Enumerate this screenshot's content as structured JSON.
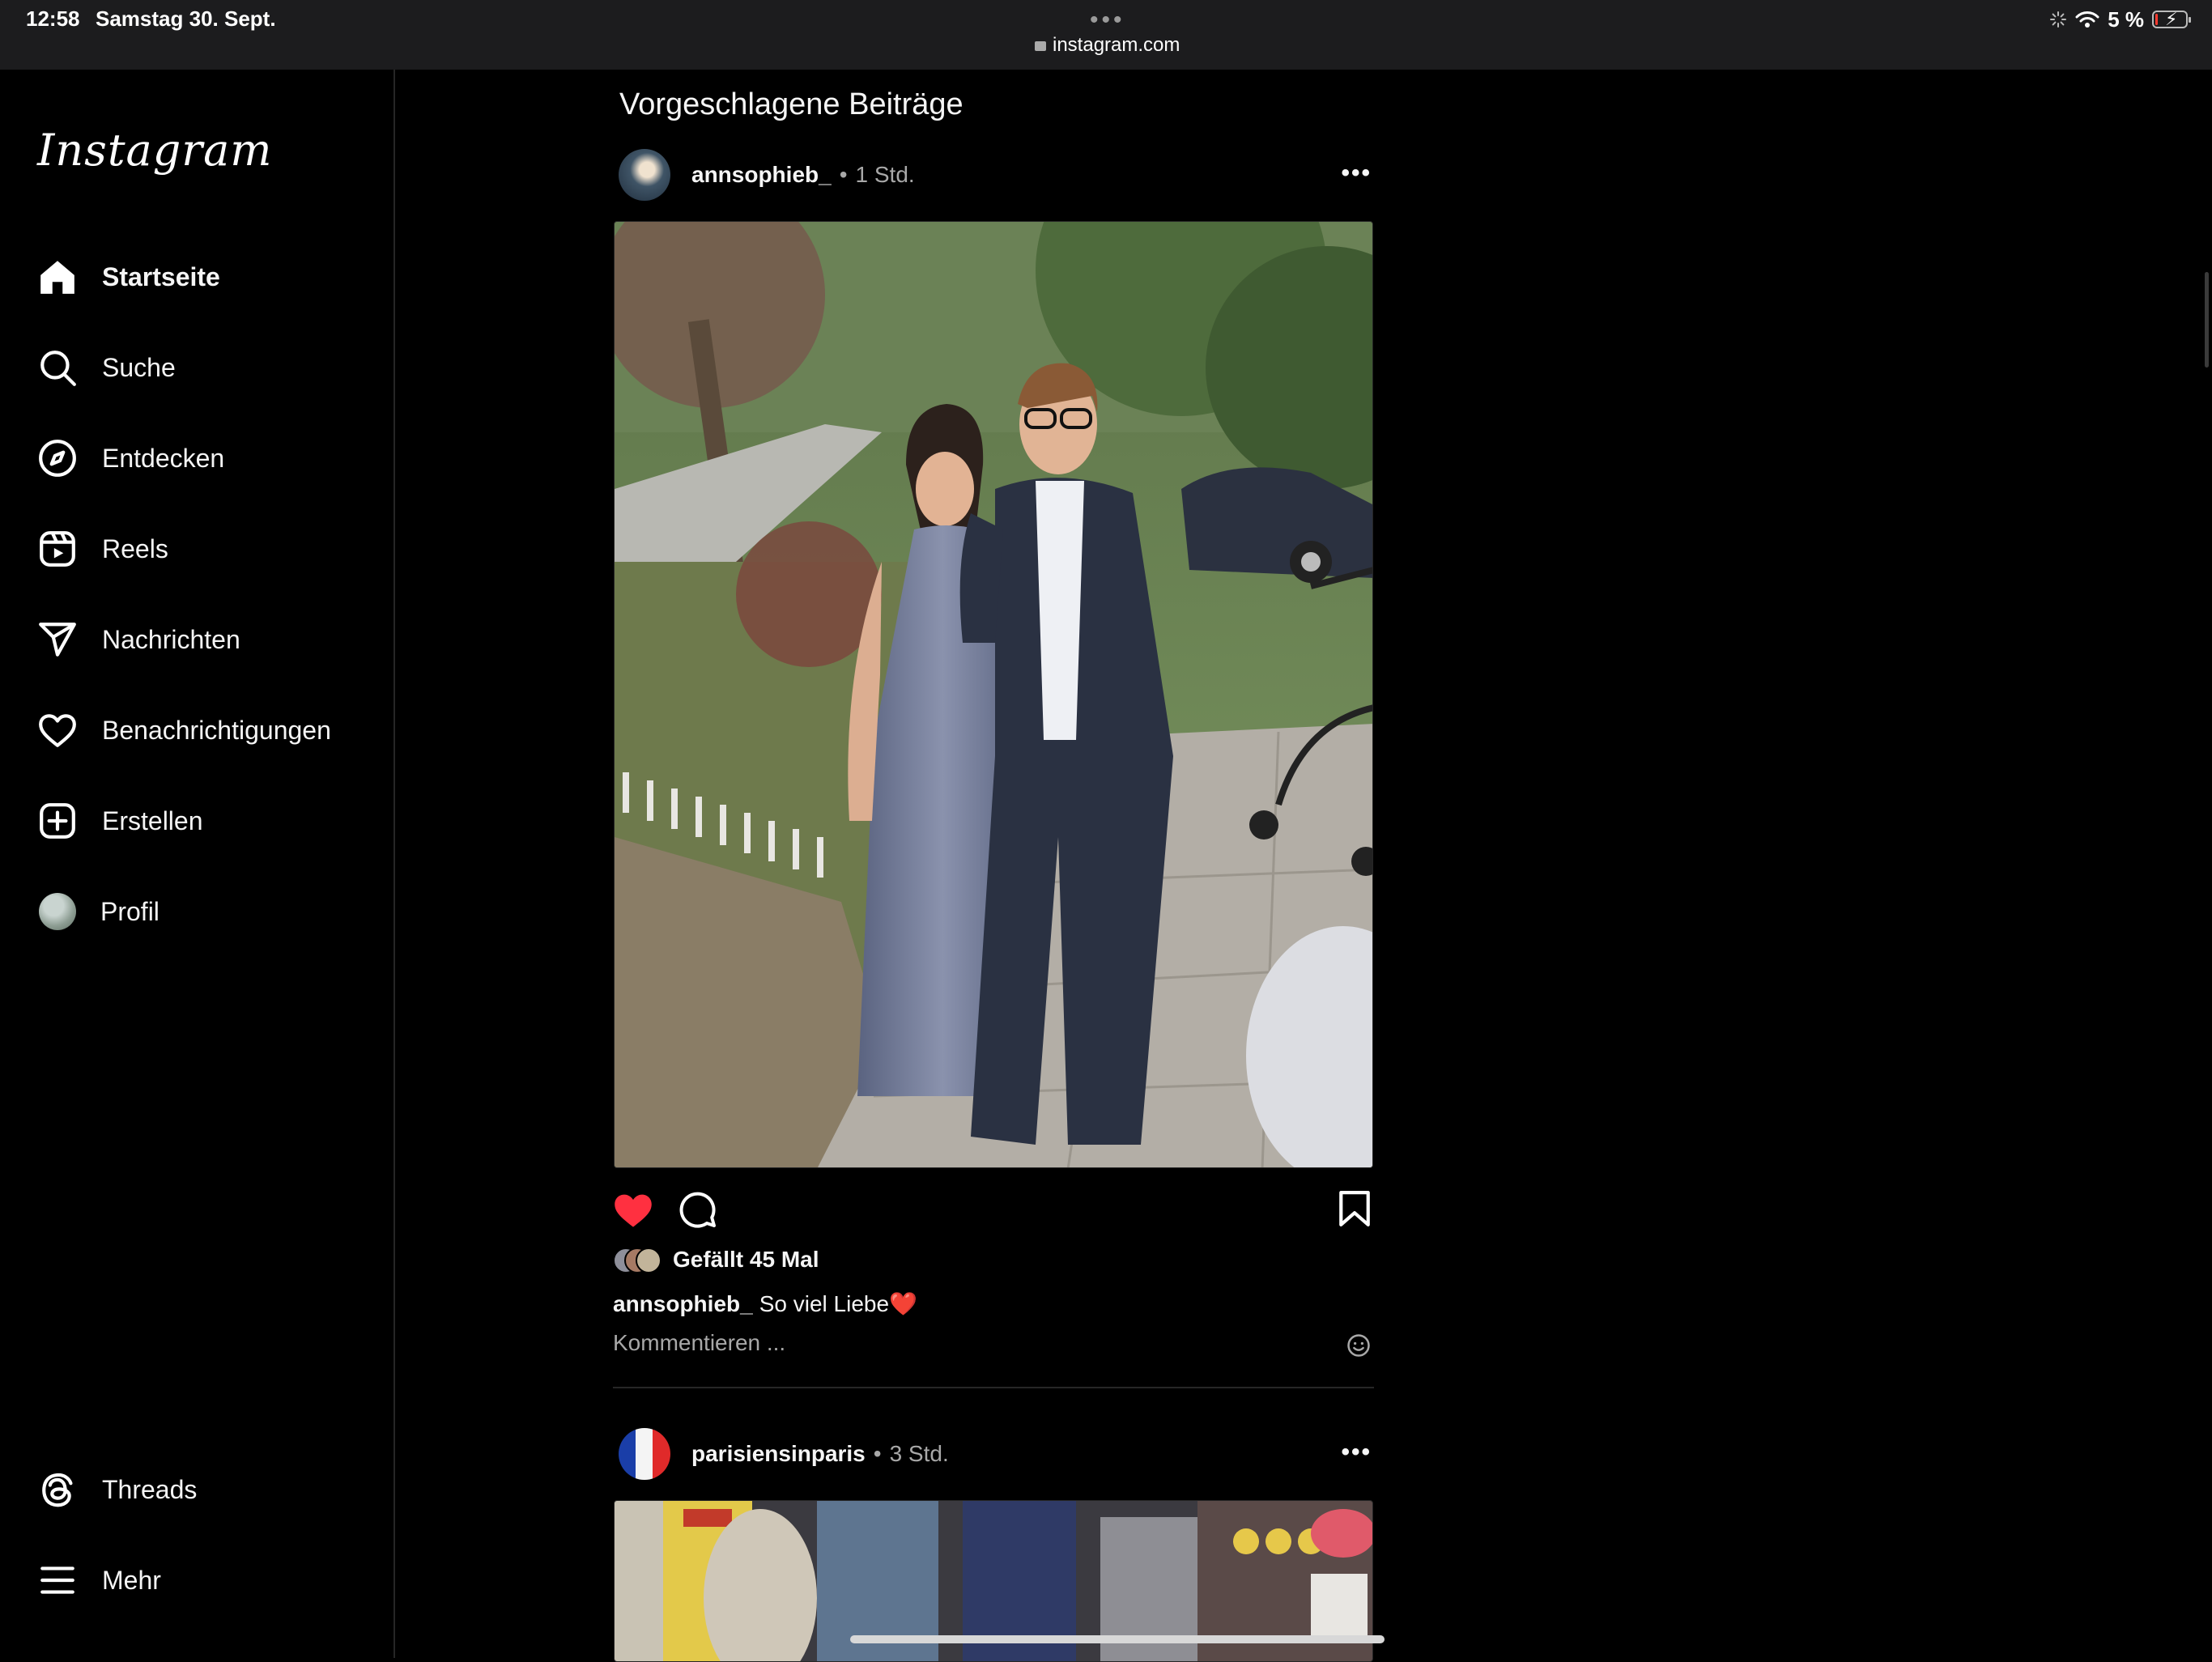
{
  "status_bar": {
    "time": "12:58",
    "date": "Samstag 30. Sept.",
    "dots": "•••",
    "url": "instagram.com",
    "battery": "5 %",
    "battery_level_percent": 5
  },
  "sidebar": {
    "logo": "Instagram",
    "items": [
      {
        "label": "Startseite",
        "icon": "home-icon",
        "active": true
      },
      {
        "label": "Suche",
        "icon": "search-icon"
      },
      {
        "label": "Entdecken",
        "icon": "compass-icon"
      },
      {
        "label": "Reels",
        "icon": "reels-icon"
      },
      {
        "label": "Nachrichten",
        "icon": "send-icon"
      },
      {
        "label": "Benachrichtigungen",
        "icon": "heart-icon"
      },
      {
        "label": "Erstellen",
        "icon": "plus-square-icon"
      },
      {
        "label": "Profil",
        "icon": "avatar"
      }
    ],
    "bottom_items": [
      {
        "label": "Threads",
        "icon": "threads-icon"
      },
      {
        "label": "Mehr",
        "icon": "menu-icon"
      }
    ]
  },
  "feed": {
    "title": "Vorgeschlagene Beiträge",
    "posts": [
      {
        "username": "annsophieb_",
        "separator": "•",
        "time": "1 Std.",
        "more": "•••",
        "liked": true,
        "likes_text": "Gefällt 45 Mal",
        "caption_user": "annsophieb_",
        "caption_text": "So viel Liebe❤️",
        "comment_placeholder": "Kommentieren ..."
      },
      {
        "username": "parisiensinparis",
        "separator": "•",
        "time": "3 Std.",
        "more": "•••"
      }
    ]
  },
  "colors": {
    "background": "#000000",
    "text": "#f5f5f5",
    "secondary_text": "#a8a8a8",
    "like_red": "#ff3040",
    "divider": "#262626"
  }
}
